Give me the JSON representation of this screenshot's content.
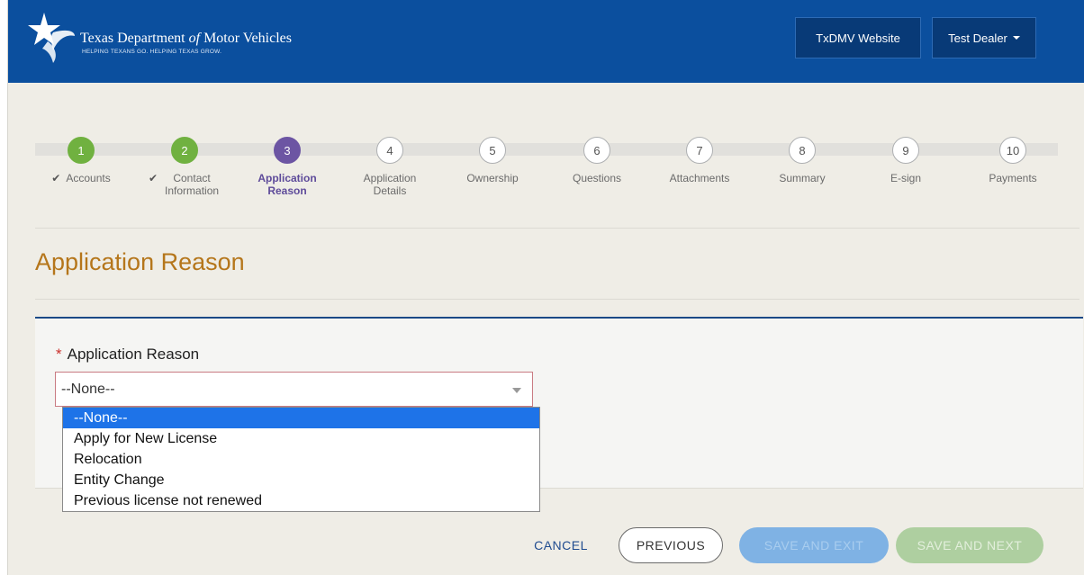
{
  "header": {
    "agency_title": "Texas Department of Motor Vehicles",
    "agency_title_prefix": "Texas Department ",
    "agency_title_of": "of",
    "agency_title_suffix": " Motor Vehicles",
    "tagline": "HELPING TEXANS GO. HELPING TEXAS GROW.",
    "website_button": "TxDMV Website",
    "user_menu": "Test Dealer",
    "brand_color": "#0b4f9e"
  },
  "stepper": {
    "steps": [
      {
        "number": "1",
        "label": "Accounts",
        "status": "done"
      },
      {
        "number": "2",
        "label": "Contact Information",
        "status": "done"
      },
      {
        "number": "3",
        "label": "Application Reason",
        "status": "current"
      },
      {
        "number": "4",
        "label": "Application Details",
        "status": "pending"
      },
      {
        "number": "5",
        "label": "Ownership",
        "status": "pending"
      },
      {
        "number": "6",
        "label": "Questions",
        "status": "pending"
      },
      {
        "number": "7",
        "label": "Attachments",
        "status": "pending"
      },
      {
        "number": "8",
        "label": "Summary",
        "status": "pending"
      },
      {
        "number": "9",
        "label": "E-sign",
        "status": "pending"
      },
      {
        "number": "10",
        "label": "Payments",
        "status": "pending"
      }
    ],
    "check_glyph": "✔"
  },
  "page": {
    "title": "Application Reason"
  },
  "form": {
    "required_marker": "*",
    "field_label": "Application Reason",
    "selected_value": "--None--",
    "options": [
      "--None--",
      "Apply for New License",
      "Relocation",
      "Entity Change",
      "Previous license not renewed"
    ],
    "highlighted_option": "--None--"
  },
  "footer": {
    "cancel": "CANCEL",
    "previous": "PREVIOUS",
    "save_exit": "SAVE AND EXIT",
    "save_next": "SAVE AND NEXT"
  }
}
